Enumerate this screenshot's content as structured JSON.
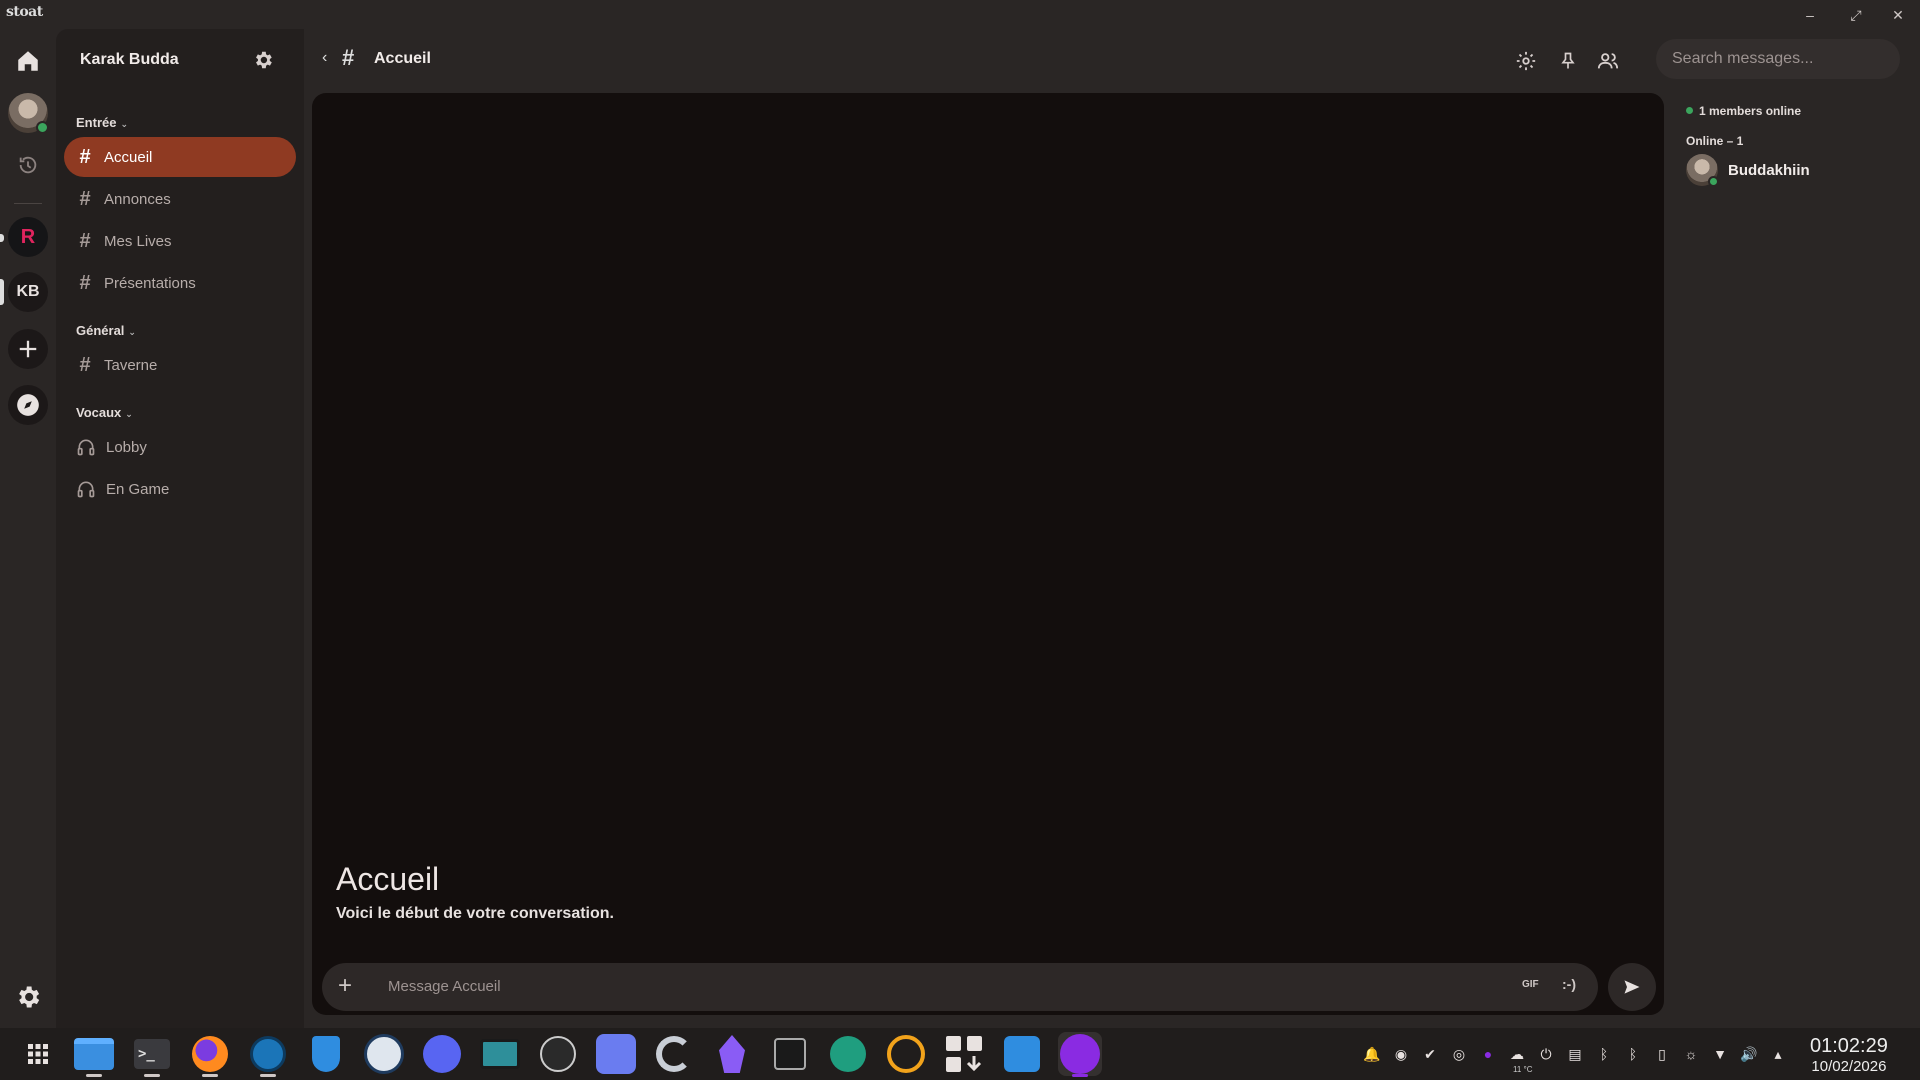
{
  "window": {
    "logo": "stoat",
    "minimize": "–",
    "maximize": "⤢",
    "close": "✕"
  },
  "rail": {
    "items": [
      {
        "name": "home",
        "icon": "home-icon"
      },
      {
        "name": "user-avatar",
        "icon": "avatar"
      },
      {
        "name": "history",
        "icon": "history-icon"
      },
      {
        "name": "server-r",
        "label": "R"
      },
      {
        "name": "server-kb",
        "label": "KB"
      },
      {
        "name": "add-server",
        "icon": "plus-icon"
      },
      {
        "name": "discover",
        "icon": "compass-icon"
      }
    ],
    "settings_icon": "gear-icon"
  },
  "sidebar": {
    "server_name": "Karak Budda",
    "categories": [
      {
        "label": "Entrée",
        "channels": [
          "Accueil",
          "Annonces",
          "Mes Lives",
          "Présentations"
        ]
      },
      {
        "label": "Général",
        "channels": [
          "Taverne"
        ]
      },
      {
        "label": "Vocaux",
        "channels": [
          "Lobby",
          "En Game"
        ]
      }
    ],
    "active_channel": "Accueil"
  },
  "header": {
    "channel": "Accueil",
    "search_placeholder": "Search messages..."
  },
  "chat": {
    "welcome_title": "Accueil",
    "welcome_subtitle": "Voici le début de votre conversation.",
    "composer_placeholder": "Message Accueil",
    "gif_label": "GIF",
    "emoji_label": ":-)"
  },
  "members": {
    "online_count": "1 members online",
    "group_label": "Online – 1",
    "list": [
      {
        "name": "Buddakhiin",
        "status": "online"
      }
    ]
  },
  "taskbar": {
    "clock_time": "01:02:29",
    "clock_date": "10/02/2026",
    "weather": "11 °C"
  },
  "colors": {
    "accent": "#8f3a22",
    "online": "#3ba55d",
    "chat_bg": "#130e0d",
    "sidebar_bg": "#231f1e",
    "app_bg": "#2a2625"
  }
}
